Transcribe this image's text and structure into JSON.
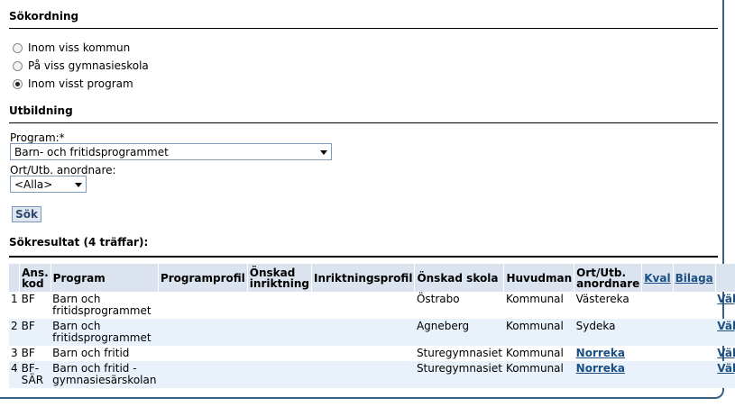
{
  "sokordning": {
    "heading": "Sökordning",
    "options": [
      {
        "label": "Inom viss kommun",
        "checked": false
      },
      {
        "label": "På viss gymnasieskola",
        "checked": false
      },
      {
        "label": "Inom visst program",
        "checked": true
      }
    ]
  },
  "utbildning": {
    "heading": "Utbildning",
    "program_label": "Program:*",
    "program_value": "Barn- och fritidsprogrammet",
    "ort_label": "Ort/Utb. anordnare:",
    "ort_value": "<Alla>"
  },
  "search_button": "Sök",
  "results": {
    "heading": "Sökresultat (4 träffar):",
    "columns": {
      "num": "",
      "ans_kod": "Ans. kod",
      "program": "Program",
      "programprofil": "Programprofil",
      "onskad_inriktning": "Önskad inriktning",
      "inriktningsprofil": "Inriktningsprofil",
      "onskad_skola": "Önskad skola",
      "huvudman": "Huvudman",
      "ort": "Ort/Utb. anordnare",
      "kval": "Kval",
      "bilaga": "Bilaga"
    },
    "rows": [
      {
        "num": "1",
        "kod": "BF",
        "program": "Barn och fritidsprogrammet",
        "skola": "Östrabo",
        "huvudman": "Kommunal",
        "ort": "Västereka",
        "ort_link": false,
        "action": "Välj"
      },
      {
        "num": "2",
        "kod": "BF",
        "program": "Barn och fritidsprogrammet",
        "skola": "Agneberg",
        "huvudman": "Kommunal",
        "ort": "Sydeka",
        "ort_link": false,
        "action": "Välj"
      },
      {
        "num": "3",
        "kod": "BF",
        "program": "Barn och fritid",
        "skola": "Sturegymnasiet",
        "huvudman": "Kommunal",
        "ort": "Norreka",
        "ort_link": true,
        "action": "Välj"
      },
      {
        "num": "4",
        "kod": "BF-SÄR",
        "program": "Barn och fritid - gymnasiesärskolan",
        "skola": "Sturegymnasiet",
        "huvudman": "Kommunal",
        "ort": "Norreka",
        "ort_link": true,
        "action": "Välj"
      }
    ]
  },
  "colors": {
    "header_bg": "#dbe3ee",
    "alt_row_bg": "#e9f1fa",
    "link": "#1a4f85",
    "frame": "#3a5f86"
  }
}
